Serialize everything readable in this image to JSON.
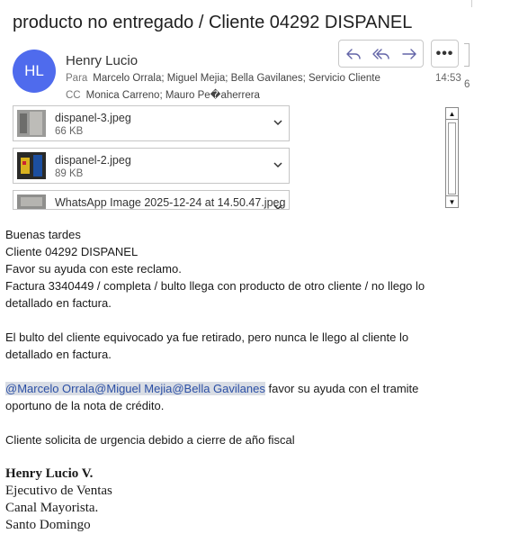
{
  "email": {
    "subject": "producto no entregado / Cliente 04292 DISPANEL",
    "sender_initials": "HL",
    "sender_name": "Henry Lucio",
    "to_label": "Para",
    "to": "Marcelo Orrala; Miguel Mejia; Bella Gavilanes; Servicio Cliente",
    "cc_label": "CC",
    "cc": "Monica Carreno; Mauro Pe�aherrera",
    "time": "14:53",
    "time_overflow": "6",
    "more_label": "•••"
  },
  "attachments": [
    {
      "name": "dispanel-3.jpeg",
      "size": "66 KB"
    },
    {
      "name": "dispanel-2.jpeg",
      "size": "89 KB"
    },
    {
      "name": "WhatsApp Image 2025-12-24 at 14.50.47.jpeg",
      "size": ""
    }
  ],
  "scrollbar": {
    "up": "▲",
    "down": "▼"
  },
  "body": {
    "l1": "Buenas tardes",
    "l2": "Cliente 04292 DISPANEL",
    "l3": "Favor su ayuda con este reclamo.",
    "l4": "Factura 3340449 / completa / bulto llega con producto de otro cliente / no llego lo",
    "l5": "detallado en factura.",
    "l6": "El bulto del cliente equivocado ya fue retirado, pero nunca le llego al cliente lo",
    "l7": "detallado en factura.",
    "mentions": "@Marcelo Orrala@Miguel Mejia@Bella Gavilanes",
    "l8_rest": " favor su ayuda con el tramite",
    "l9": "oportuno de la nota de crédito.",
    "l10": "Cliente solicita de urgencia debido a cierre de año fiscal"
  },
  "signature": {
    "name": "Henry Lucio V.",
    "title": "Ejecutivo de Ventas",
    "channel": "Canal Mayorista.",
    "city": "Santo Domingo"
  },
  "colors": {
    "avatar": "#4f6bed",
    "action_icon": "#6264a7",
    "mention_bg": "#d9dde4",
    "mention_text": "#2b4fa5"
  }
}
